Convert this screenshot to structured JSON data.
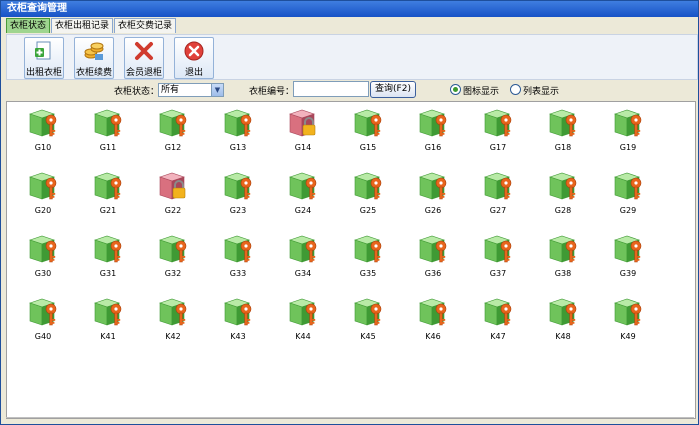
{
  "window": {
    "title": "衣柜查询管理"
  },
  "tabs": [
    {
      "label": "衣柜状态",
      "active": true
    },
    {
      "label": "衣柜出租记录",
      "active": false
    },
    {
      "label": "衣柜交费记录",
      "active": false
    }
  ],
  "toolbar": {
    "rent_label": "出租衣柜",
    "renew_label": "衣柜续费",
    "return_label": "会员退柜",
    "exit_label": "退出"
  },
  "filter": {
    "status_label": "衣柜状态：",
    "status_value": "所有",
    "number_label": "衣柜编号：",
    "number_value": "",
    "query_label": "查询(F2)",
    "icon_view_label": "图标显示",
    "list_view_label": "列表显示",
    "icon_view_selected": true
  },
  "colors": {
    "available": "#6fc35b",
    "occupied": "#d9707f",
    "key": "#e8651c",
    "lock": "#f2b21d"
  },
  "lockers": [
    {
      "name": "G10",
      "status": "available"
    },
    {
      "name": "G11",
      "status": "available"
    },
    {
      "name": "G12",
      "status": "available"
    },
    {
      "name": "G13",
      "status": "available"
    },
    {
      "name": "G14",
      "status": "occupied"
    },
    {
      "name": "G15",
      "status": "available"
    },
    {
      "name": "G16",
      "status": "available"
    },
    {
      "name": "G17",
      "status": "available"
    },
    {
      "name": "G18",
      "status": "available"
    },
    {
      "name": "G19",
      "status": "available"
    },
    {
      "name": "G20",
      "status": "available"
    },
    {
      "name": "G21",
      "status": "available"
    },
    {
      "name": "G22",
      "status": "occupied"
    },
    {
      "name": "G23",
      "status": "available"
    },
    {
      "name": "G24",
      "status": "available"
    },
    {
      "name": "G25",
      "status": "available"
    },
    {
      "name": "G26",
      "status": "available"
    },
    {
      "name": "G27",
      "status": "available"
    },
    {
      "name": "G28",
      "status": "available"
    },
    {
      "name": "G29",
      "status": "available"
    },
    {
      "name": "G30",
      "status": "available"
    },
    {
      "name": "G31",
      "status": "available"
    },
    {
      "name": "G32",
      "status": "available"
    },
    {
      "name": "G33",
      "status": "available"
    },
    {
      "name": "G34",
      "status": "available"
    },
    {
      "name": "G35",
      "status": "available"
    },
    {
      "name": "G36",
      "status": "available"
    },
    {
      "name": "G37",
      "status": "available"
    },
    {
      "name": "G38",
      "status": "available"
    },
    {
      "name": "G39",
      "status": "available"
    },
    {
      "name": "G40",
      "status": "available"
    },
    {
      "name": "K41",
      "status": "available"
    },
    {
      "name": "K42",
      "status": "available"
    },
    {
      "name": "K43",
      "status": "available"
    },
    {
      "name": "K44",
      "status": "available"
    },
    {
      "name": "K45",
      "status": "available"
    },
    {
      "name": "K46",
      "status": "available"
    },
    {
      "name": "K47",
      "status": "available"
    },
    {
      "name": "K48",
      "status": "available"
    },
    {
      "name": "K49",
      "status": "available"
    }
  ]
}
